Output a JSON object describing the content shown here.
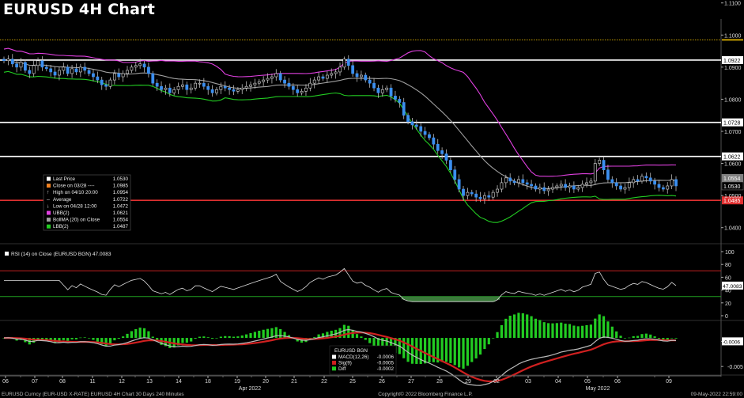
{
  "header": {
    "title": "EURUSD 4H Chart"
  },
  "colors": {
    "up": "#3b8ff0",
    "down": "#3b8ff0",
    "ubb": "#e040e0",
    "bollma": "#a0a0a0",
    "lbb": "#22cc22",
    "last_line": "#e03030",
    "macd": "#ffffff",
    "sig": "#d02020",
    "diff": "#22cc22",
    "avg_line": "#c8a000"
  },
  "chart_data": {
    "type": "candlestick",
    "x_ticks": [
      "06",
      "07",
      "08",
      "11",
      "12",
      "13",
      "14",
      "18",
      "19",
      "20",
      "21",
      "22",
      "25",
      "26",
      "27",
      "28",
      "29",
      "02",
      "03",
      "04",
      "05",
      "06",
      "09"
    ],
    "x_months": [
      "Apr 2022",
      "May 2022"
    ],
    "price_axis": {
      "min": 1.035,
      "max": 1.105,
      "ticks": [
        "1.1100",
        "1.1000",
        "1.0900",
        "1.0800",
        "1.0700",
        "1.0600",
        "1.0500",
        "1.0400"
      ]
    },
    "hlines": [
      {
        "value": 1.0922,
        "label": "1.0922",
        "color": "#ffffff"
      },
      {
        "value": 1.0728,
        "label": "1.0728",
        "color": "#ffffff"
      },
      {
        "value": 1.0622,
        "label": "1.0622",
        "color": "#ffffff"
      },
      {
        "value": 1.0485,
        "label": "1.0485",
        "color": "#e03030"
      }
    ],
    "avg_line_value": 1.0985,
    "price_labels": [
      {
        "value": 1.0554,
        "label": "1.0554",
        "bg": "#808080",
        "fg": "#ffffff"
      },
      {
        "value": 1.053,
        "label": "1.0530",
        "bg": "#000000",
        "fg": "#ffffff"
      }
    ],
    "closes": [
      1.092,
      1.0925,
      1.091,
      1.09,
      1.0915,
      1.089,
      1.088,
      1.0905,
      1.092,
      1.09,
      1.0895,
      1.0885,
      1.0875,
      1.089,
      1.09,
      1.088,
      1.0895,
      1.0885,
      1.09,
      1.089,
      1.088,
      1.087,
      1.086,
      1.0845,
      1.084,
      1.086,
      1.088,
      1.087,
      1.088,
      1.089,
      1.09,
      1.0905,
      1.091,
      1.09,
      1.088,
      1.085,
      1.084,
      1.083,
      1.0835,
      1.082,
      1.083,
      1.084,
      1.0845,
      1.083,
      1.0835,
      1.085,
      1.085,
      1.084,
      1.083,
      1.082,
      1.083,
      1.084,
      1.0835,
      1.083,
      1.0825,
      1.083,
      1.0835,
      1.084,
      1.0845,
      1.085,
      1.0855,
      1.086,
      1.0865,
      1.087,
      1.088,
      1.086,
      1.085,
      1.084,
      1.083,
      1.082,
      1.0825,
      1.0835,
      1.085,
      1.086,
      1.087,
      1.0865,
      1.0875,
      1.088,
      1.0885,
      1.09,
      1.0925,
      1.0905,
      1.088,
      1.087,
      1.0875,
      1.086,
      1.085,
      1.0835,
      1.082,
      1.083,
      1.0835,
      1.081,
      1.08,
      1.079,
      1.075,
      1.073,
      1.072,
      1.0715,
      1.07,
      1.069,
      1.068,
      1.066,
      1.064,
      1.063,
      1.061,
      1.058,
      1.055,
      1.052,
      1.05,
      1.051,
      1.0505,
      1.0495,
      1.049,
      1.05,
      1.0495,
      1.051,
      1.052,
      1.054,
      1.0555,
      1.0545,
      1.054,
      1.055,
      1.054,
      1.0535,
      1.053,
      1.052,
      1.0525,
      1.0515,
      1.052,
      1.0525,
      1.053,
      1.0535,
      1.0525,
      1.053,
      1.052,
      1.0525,
      1.0535,
      1.054,
      1.0545,
      1.06,
      1.061,
      1.058,
      1.055,
      1.054,
      1.053,
      1.052,
      1.0525,
      1.054,
      1.055,
      1.0545,
      1.056,
      1.0555,
      1.0545,
      1.0535,
      1.0525,
      1.052,
      1.053,
      1.055,
      1.053
    ],
    "legend": [
      {
        "label": "Last Price",
        "value": "1.0530",
        "marker": "square",
        "color": "#ffffff"
      },
      {
        "label": "Close on 03/28 ----",
        "value": "1.0985",
        "marker": "square",
        "color": "#f08020"
      },
      {
        "label": "High on 04/10 20:00",
        "value": "1.0954",
        "marker": "high",
        "color": "#ffffff"
      },
      {
        "label": "Average",
        "value": "1.0722",
        "marker": "avg",
        "color": "#ffffff"
      },
      {
        "label": "Low on 04/28 12:00",
        "value": "1.0472",
        "marker": "low",
        "color": "#ffffff"
      },
      {
        "label": "UBB(2)",
        "value": "1.0621",
        "marker": "square",
        "color": "#e040e0"
      },
      {
        "label": "BollMA (20) on Close",
        "value": "1.0554",
        "marker": "square",
        "color": "#a0a0a0"
      },
      {
        "label": "LBB(2)",
        "value": "1.0487",
        "marker": "square",
        "color": "#22cc22"
      }
    ],
    "rsi": {
      "title": "RSI (14) on Close (EURUSD BGN) 47.0083",
      "ticks": [
        "100",
        "80",
        "60",
        "40",
        "20",
        "0"
      ],
      "range": [
        0,
        100
      ],
      "overbought": 70,
      "oversold": 30,
      "last_label": "47.0083",
      "last_value": 47.0083
    },
    "macd": {
      "ticks": [
        "-0.0006",
        "-0.005"
      ],
      "legend_title": "EURUSD BGN",
      "legend": [
        {
          "label": "MACD(12,26)",
          "value": "-0.0006",
          "color": "#ffffff"
        },
        {
          "label": "Sig(9)",
          "value": "-0.0005",
          "color": "#d02020"
        },
        {
          "label": "Diff",
          "value": "-0.0002",
          "color": "#22cc22"
        }
      ],
      "last_label": "-0.0006"
    }
  },
  "footer": {
    "left": "EURUSD Curncy (EUR-USD X-RATE) EURUSD 4H Chart 30 Days 240 Minutes",
    "center": "Copyright© 2022 Bloomberg Finance L.P.",
    "right": "09-May-2022 22:59:00"
  }
}
